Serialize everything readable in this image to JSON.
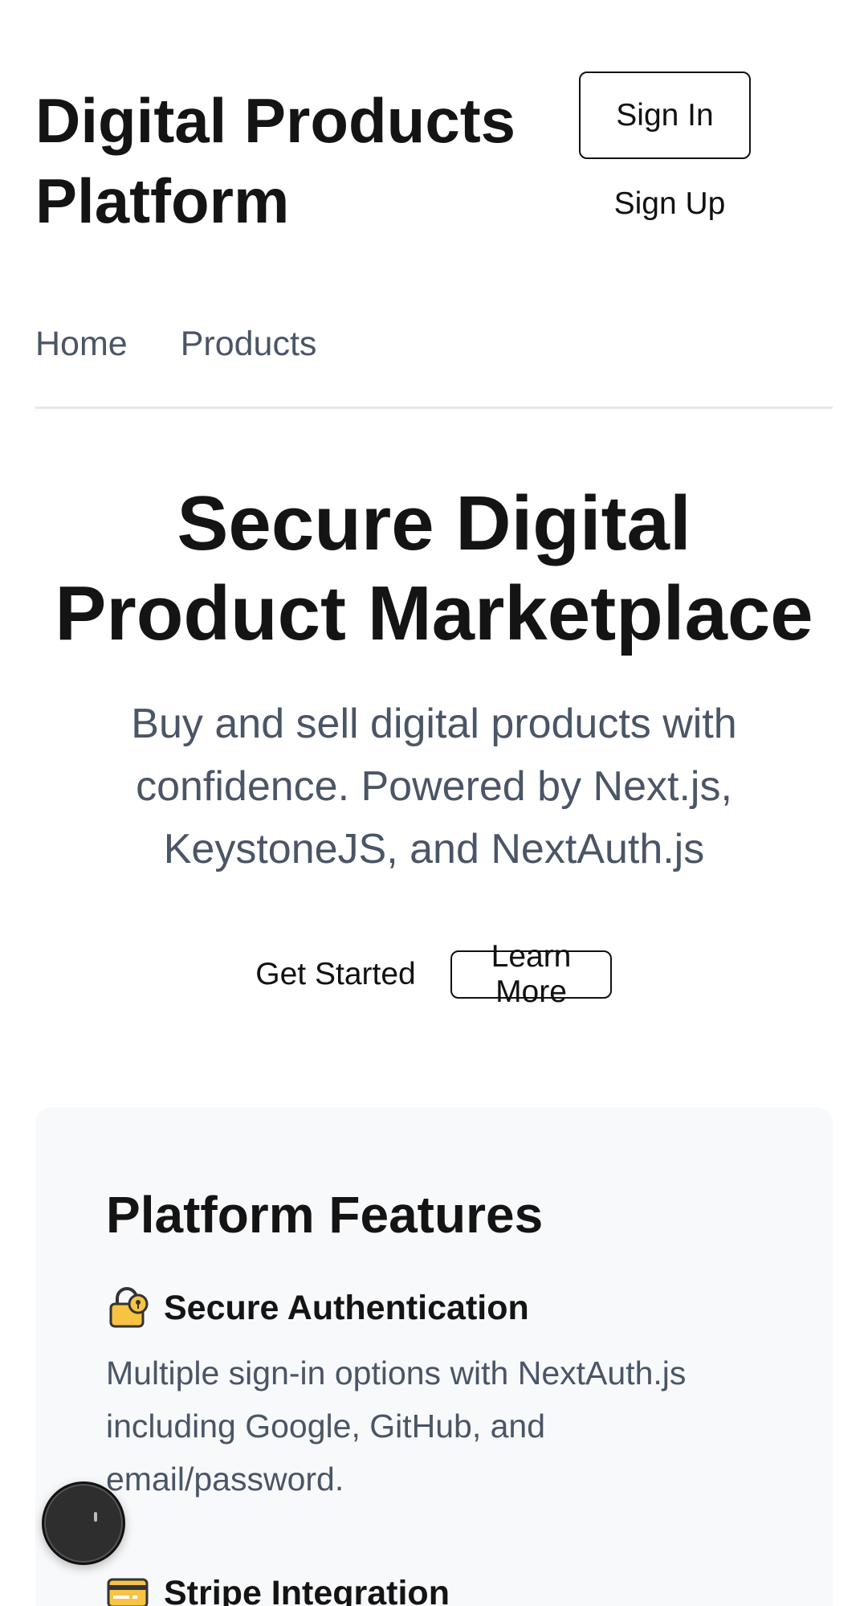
{
  "header": {
    "site_title": "Digital Products Platform",
    "sign_in_label": "Sign In",
    "sign_up_label": "Sign Up"
  },
  "nav": {
    "items": [
      {
        "label": "Home"
      },
      {
        "label": "Products"
      }
    ]
  },
  "hero": {
    "title": "Secure Digital Product Marketplace",
    "subtitle": "Buy and sell digital products with confidence. Powered by Next.js, KeystoneJS, and NextAuth.js",
    "primary_action_label": "Get Started",
    "secondary_action_label": "Learn More"
  },
  "features": {
    "title": "Platform Features",
    "items": [
      {
        "icon": "lock-icon",
        "title": "Secure Authentication",
        "description": "Multiple sign-in options with NextAuth.js including Google, GitHub, and email/password."
      },
      {
        "icon": "credit-card-icon",
        "title": "Stripe Integration"
      }
    ]
  },
  "colors": {
    "text_primary": "#141414",
    "text_secondary": "#4a5566",
    "divider": "#e5e7eb",
    "card_background": "#f8f9fb",
    "icon_gold": "#f6c343"
  }
}
